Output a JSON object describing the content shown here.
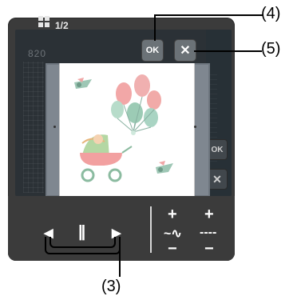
{
  "screen": {
    "page_indicator": "1/2",
    "dimmed_label": "820"
  },
  "buttons": {
    "ok_label": "OK",
    "close_label": "✕",
    "side_ok_label": "OK",
    "side_close_label": "✕"
  },
  "controls": {
    "prev_symbol": "◀",
    "pause_symbol": "||",
    "next_symbol": "▶",
    "plus": "+",
    "minus": "−",
    "stitch_zigzag": "~∿",
    "stitch_dash": "----"
  },
  "callouts": {
    "c4": "(4)",
    "c5": "(5)",
    "c3": "(3)"
  },
  "colors": {
    "panel": "#3b3b3b",
    "screen": "#2b3136",
    "button": "#6b7277"
  }
}
